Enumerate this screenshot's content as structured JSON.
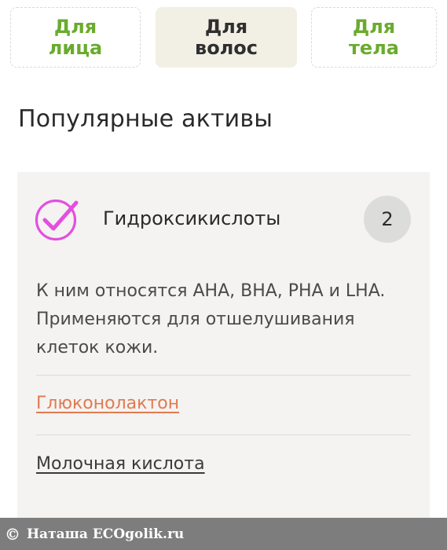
{
  "tabs": [
    {
      "line1": "Для",
      "line2": "лица",
      "active": false
    },
    {
      "line1": "Для",
      "line2": "волос",
      "active": true
    },
    {
      "line1": "Для",
      "line2": "тела",
      "active": false
    }
  ],
  "section": {
    "title": "Популярные активы"
  },
  "card": {
    "icon": "check-circle-icon",
    "title": "Гидроксикислоты",
    "count": "2",
    "description": "К ним относятся AHA, BHA, PHA и LHA. Применяются для отшелушивания клеток кожи.",
    "links": [
      {
        "label": "Глюконолактон",
        "color": "#e07a52"
      },
      {
        "label": "Молочная кислота",
        "color": "#3a3a3a"
      }
    ]
  },
  "footer": {
    "copyright_symbol": "©",
    "text": "Наташа ECOgolik.ru"
  },
  "colors": {
    "accent_green": "#6aab2e",
    "accent_magenta": "#e34fe0",
    "active_tab_bg": "#f2efe4",
    "card_bg": "#f4f3f1"
  }
}
